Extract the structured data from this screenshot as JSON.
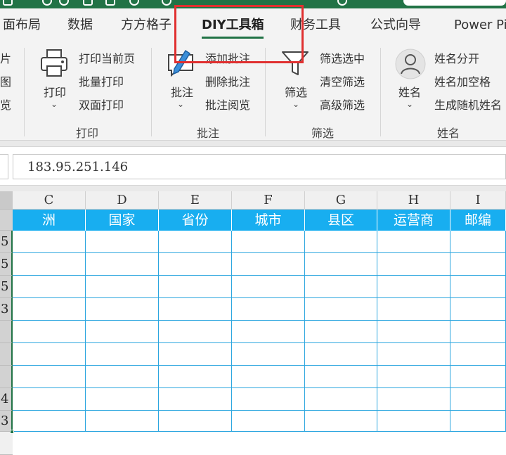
{
  "tabs": [
    "面布局",
    "数据",
    "方方格子",
    "DIY工具箱",
    "财务工具",
    "公式向导",
    "Power Pi"
  ],
  "active_tab": "DIY工具箱",
  "ribbon": {
    "left_partial": [
      "片",
      "图",
      "览"
    ],
    "print_group": {
      "button": "打印",
      "items": [
        "打印当前页",
        "批量打印",
        "双面打印"
      ],
      "label": "打印"
    },
    "comment_group": {
      "button": "批注",
      "items": [
        "添加批注",
        "删除批注",
        "批注阅览"
      ],
      "label": "批注"
    },
    "filter_group": {
      "button": "筛选",
      "items": [
        "筛选选中",
        "清空筛选",
        "高级筛选"
      ],
      "label": "筛选"
    },
    "name_group": {
      "button": "姓名",
      "items": [
        "姓名分开",
        "姓名加空格",
        "生成随机姓名"
      ],
      "label": "姓名"
    }
  },
  "formula_bar": {
    "value": "183.95.251.146"
  },
  "sheet": {
    "columns": [
      "C",
      "D",
      "E",
      "F",
      "G",
      "H",
      "I"
    ],
    "headers": [
      "洲",
      "国家",
      "省份",
      "城市",
      "县区",
      "运营商",
      "邮编"
    ],
    "row_numbers": [
      "5",
      "5",
      "5",
      "3",
      "",
      "",
      "",
      "4",
      "3"
    ]
  },
  "colors": {
    "accent_green": "#217346",
    "header_blue": "#18aef0",
    "grid_blue": "#2ba6df",
    "highlight_red": "#e03030"
  }
}
